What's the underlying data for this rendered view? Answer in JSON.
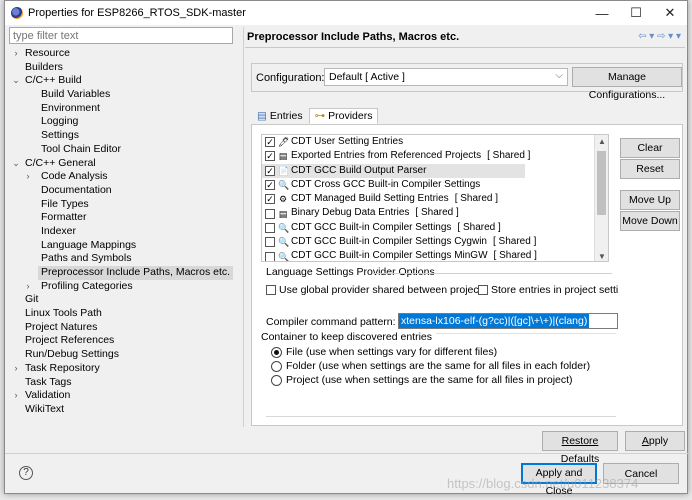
{
  "window": {
    "title": "Properties for ESP8266_RTOS_SDK-master",
    "minimize": "—",
    "maximize": "☐",
    "close": "✕"
  },
  "filter": {
    "placeholder": "type filter text"
  },
  "tree": [
    {
      "label": "Resource",
      "indent": 0,
      "twisty": "›"
    },
    {
      "label": "Builders",
      "indent": 0,
      "twisty": ""
    },
    {
      "label": "C/C++ Build",
      "indent": 0,
      "twisty": "⌄"
    },
    {
      "label": "Build Variables",
      "indent": 1,
      "twisty": ""
    },
    {
      "label": "Environment",
      "indent": 1,
      "twisty": ""
    },
    {
      "label": "Logging",
      "indent": 1,
      "twisty": ""
    },
    {
      "label": "Settings",
      "indent": 1,
      "twisty": ""
    },
    {
      "label": "Tool Chain Editor",
      "indent": 1,
      "twisty": ""
    },
    {
      "label": "C/C++ General",
      "indent": 0,
      "twisty": "⌄"
    },
    {
      "label": "Code Analysis",
      "indent": 1,
      "twisty": "›"
    },
    {
      "label": "Documentation",
      "indent": 1,
      "twisty": ""
    },
    {
      "label": "File Types",
      "indent": 1,
      "twisty": ""
    },
    {
      "label": "Formatter",
      "indent": 1,
      "twisty": ""
    },
    {
      "label": "Indexer",
      "indent": 1,
      "twisty": ""
    },
    {
      "label": "Language Mappings",
      "indent": 1,
      "twisty": ""
    },
    {
      "label": "Paths and Symbols",
      "indent": 1,
      "twisty": ""
    },
    {
      "label": "Preprocessor Include Paths, Macros etc.",
      "indent": 1,
      "twisty": "",
      "selected": true
    },
    {
      "label": "Profiling Categories",
      "indent": 1,
      "twisty": "›"
    },
    {
      "label": "Git",
      "indent": 0,
      "twisty": ""
    },
    {
      "label": "Linux Tools Path",
      "indent": 0,
      "twisty": ""
    },
    {
      "label": "Project Natures",
      "indent": 0,
      "twisty": ""
    },
    {
      "label": "Project References",
      "indent": 0,
      "twisty": ""
    },
    {
      "label": "Run/Debug Settings",
      "indent": 0,
      "twisty": ""
    },
    {
      "label": "Task Repository",
      "indent": 0,
      "twisty": "›"
    },
    {
      "label": "Task Tags",
      "indent": 0,
      "twisty": ""
    },
    {
      "label": "Validation",
      "indent": 0,
      "twisty": "›"
    },
    {
      "label": "WikiText",
      "indent": 0,
      "twisty": ""
    }
  ],
  "page": {
    "title": "Preprocessor Include Paths, Macros etc.",
    "nav": "⇦ ▾ ⇨ ▾ ▾",
    "config_label": "Configuration:",
    "config_value": "Default  [ Active ]",
    "manage_button": "Manage Configurations...",
    "tabs": [
      {
        "label": "Entries",
        "icon": "▤"
      },
      {
        "label": "Providers",
        "icon": "⊶"
      }
    ]
  },
  "providers": [
    {
      "label": "CDT User Setting Entries",
      "checked": true,
      "icon": "🖊",
      "tag": ""
    },
    {
      "label": "Exported Entries from Referenced Projects",
      "checked": true,
      "icon": "▤",
      "tag": "[ Shared ]"
    },
    {
      "label": "CDT GCC Build Output Parser",
      "checked": true,
      "icon": "📄",
      "tag": "",
      "selected": true
    },
    {
      "label": "CDT Cross GCC Built-in Compiler Settings",
      "checked": true,
      "icon": "🔍",
      "tag": ""
    },
    {
      "label": "CDT Managed Build Setting Entries",
      "checked": true,
      "icon": "⚙",
      "tag": "[ Shared ]"
    },
    {
      "label": "Binary Debug Data Entries",
      "checked": false,
      "icon": "▤",
      "tag": "[ Shared ]"
    },
    {
      "label": "CDT GCC Built-in Compiler Settings",
      "checked": false,
      "icon": "🔍",
      "tag": "[ Shared ]"
    },
    {
      "label": "CDT GCC Built-in Compiler Settings Cygwin",
      "checked": false,
      "icon": "🔍",
      "tag": "[ Shared ]"
    },
    {
      "label": "CDT GCC Built-in Compiler Settings MinGW",
      "checked": false,
      "icon": "🔍",
      "tag": "[ Shared ]"
    }
  ],
  "side_buttons": {
    "clear": "Clear Entries",
    "reset": "Reset",
    "up": "Move Up",
    "down": "Move Down"
  },
  "options": {
    "title": "Language Settings Provider Options",
    "use_global": "Use global provider shared between projects",
    "store_entries": "Store entries in project setti",
    "cmd_label": "Compiler command pattern:",
    "cmd_value": "xtensa-lx106-elf-(g?cc)|([gc]\\+\\+)|(clang)",
    "container_title": "Container to keep discovered entries",
    "radios": [
      {
        "label": "File (use when settings vary for different files)",
        "on": true
      },
      {
        "label": "Folder (use when settings are the same for all files in each folder)",
        "on": false
      },
      {
        "label": "Project (use when settings are the same for all files in project)",
        "on": false
      }
    ]
  },
  "footer": {
    "restore": "Restore Defaults",
    "apply": "Apply",
    "apply_close": "Apply and Close",
    "cancel": "Cancel",
    "help": "?",
    "watermark": "https://blog.csdn.net/u011238374"
  }
}
